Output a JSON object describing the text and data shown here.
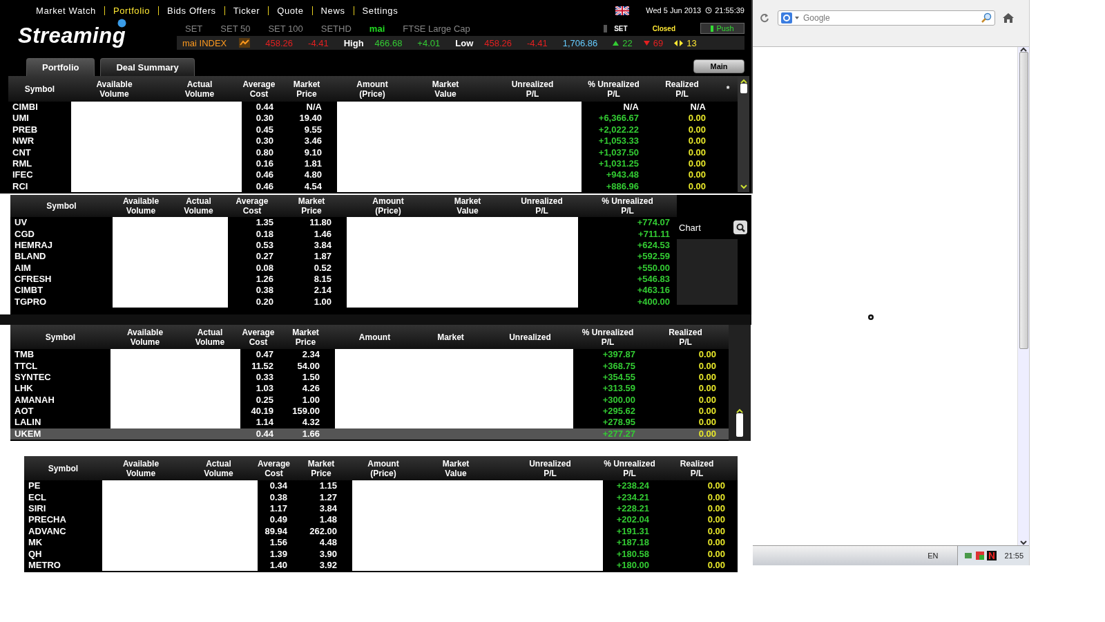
{
  "menu": [
    {
      "label": "Market Watch",
      "selected": false
    },
    {
      "label": "Portfolio",
      "selected": true
    },
    {
      "label": "Bids Offers",
      "selected": false
    },
    {
      "label": "Ticker",
      "selected": false
    },
    {
      "label": "Quote",
      "selected": false
    },
    {
      "label": "News",
      "selected": false
    },
    {
      "label": "Settings",
      "selected": false
    }
  ],
  "date": "Wed 5 Jun 2013",
  "time": "21:55:39",
  "logo": "Streaming",
  "index_tabs": [
    {
      "label": "SET",
      "selected": false
    },
    {
      "label": "SET 50",
      "selected": false
    },
    {
      "label": "SET 100",
      "selected": false
    },
    {
      "label": "SETHD",
      "selected": false
    },
    {
      "label": "mai",
      "selected": true
    },
    {
      "label": "FTSE Large Cap",
      "selected": false
    }
  ],
  "market": {
    "name": "SET",
    "status": "Closed",
    "push_button": "Push"
  },
  "ticker": [
    {
      "kind": "name",
      "text": "mai INDEX"
    },
    {
      "kind": "down",
      "text": "458.26"
    },
    {
      "kind": "down",
      "text": "-4.41"
    },
    {
      "kind": "label",
      "text": "High"
    },
    {
      "kind": "up",
      "text": "466.68"
    },
    {
      "kind": "up",
      "text": "+4.01"
    },
    {
      "kind": "label",
      "text": "Low"
    },
    {
      "kind": "down",
      "text": "458.26"
    },
    {
      "kind": "down",
      "text": "-4.41"
    },
    {
      "kind": "value",
      "text": "1,706.86"
    },
    {
      "kind": "advances",
      "text": "22"
    },
    {
      "kind": "declines",
      "text": "69"
    },
    {
      "kind": "unchanged",
      "text": "13"
    }
  ],
  "tabs": [
    {
      "label": "Portfolio",
      "selected": true
    },
    {
      "label": "Deal Summary",
      "selected": false
    }
  ],
  "main_button": "Main",
  "panels": [
    {
      "columns": [
        "Symbol",
        "Available\nVolume",
        "Actual\nVolume",
        "Average\nCost",
        "Market\nPrice",
        "Amount\n(Price)",
        "Market\nValue",
        "Unrealized\nP/L",
        "% Unrealized\nP/L",
        "Realized\nP/L",
        "*"
      ],
      "rows": [
        {
          "symbol": "CIMBI",
          "avg_cost": "0.44",
          "price": "N/A",
          "pct": "N/A",
          "realized": "N/A",
          "positive": false
        },
        {
          "symbol": "UMI",
          "avg_cost": "0.30",
          "price": "19.40",
          "pct": "+6,366.67",
          "realized": "0.00",
          "positive": true
        },
        {
          "symbol": "PREB",
          "avg_cost": "0.45",
          "price": "9.55",
          "pct": "+2,022.22",
          "realized": "0.00",
          "positive": true
        },
        {
          "symbol": "NWR",
          "avg_cost": "0.30",
          "price": "3.46",
          "pct": "+1,053.33",
          "realized": "0.00",
          "positive": true
        },
        {
          "symbol": "CNT",
          "avg_cost": "0.80",
          "price": "9.10",
          "pct": "+1,037.50",
          "realized": "0.00",
          "positive": true
        },
        {
          "symbol": "RML",
          "avg_cost": "0.16",
          "price": "1.81",
          "pct": "+1,031.25",
          "realized": "0.00",
          "positive": true
        },
        {
          "symbol": "IFEC",
          "avg_cost": "0.46",
          "price": "4.80",
          "pct": "+943.48",
          "realized": "0.00",
          "positive": true
        },
        {
          "symbol": "RCI",
          "avg_cost": "0.46",
          "price": "4.54",
          "pct": "+886.96",
          "realized": "0.00",
          "positive": true
        }
      ]
    },
    {
      "columns": [
        "Symbol",
        "Available\nVolume",
        "Actual\nVolume",
        "Average\nCost",
        "Market\nPrice",
        "Amount\n(Price)",
        "Market\nValue",
        "Unrealized\nP/L",
        "% Unrealized\nP/L"
      ],
      "rows": [
        {
          "symbol": "UV",
          "avg_cost": "1.35",
          "price": "11.80",
          "pct": "+774.07",
          "positive": true
        },
        {
          "symbol": "CGD",
          "avg_cost": "0.18",
          "price": "1.46",
          "pct": "+711.11",
          "positive": true
        },
        {
          "symbol": "HEMRAJ",
          "avg_cost": "0.53",
          "price": "3.84",
          "pct": "+624.53",
          "positive": true
        },
        {
          "symbol": "BLAND",
          "avg_cost": "0.27",
          "price": "1.87",
          "pct": "+592.59",
          "positive": true
        },
        {
          "symbol": "AIM",
          "avg_cost": "0.08",
          "price": "0.52",
          "pct": "+550.00",
          "positive": true
        },
        {
          "symbol": "CFRESH",
          "avg_cost": "1.26",
          "price": "8.15",
          "pct": "+546.83",
          "positive": true
        },
        {
          "symbol": "CIMBT",
          "avg_cost": "0.38",
          "price": "2.14",
          "pct": "+463.16",
          "positive": true
        },
        {
          "symbol": "TGPRO",
          "avg_cost": "0.20",
          "price": "1.00",
          "pct": "+400.00",
          "positive": true
        }
      ],
      "side": {
        "title": "Chart"
      }
    },
    {
      "columns": [
        "Symbol",
        "Available\nVolume",
        "Actual\nVolume",
        "Average\nCost",
        "Market\nPrice",
        "Amount",
        "Market",
        "Unrealized",
        "% Unrealized\nP/L",
        "Realized\nP/L"
      ],
      "rows": [
        {
          "symbol": "TMB",
          "avg_cost": "0.47",
          "price": "2.34",
          "pct": "+397.87",
          "realized": "0.00",
          "positive": true,
          "selected": false
        },
        {
          "symbol": "TTCL",
          "avg_cost": "11.52",
          "price": "54.00",
          "pct": "+368.75",
          "realized": "0.00",
          "positive": true,
          "selected": false
        },
        {
          "symbol": "SYNTEC",
          "avg_cost": "0.33",
          "price": "1.50",
          "pct": "+354.55",
          "realized": "0.00",
          "positive": true,
          "selected": false
        },
        {
          "symbol": "LHK",
          "avg_cost": "1.03",
          "price": "4.26",
          "pct": "+313.59",
          "realized": "0.00",
          "positive": true,
          "selected": false
        },
        {
          "symbol": "AMANAH",
          "avg_cost": "0.25",
          "price": "1.00",
          "pct": "+300.00",
          "realized": "0.00",
          "positive": true,
          "selected": false
        },
        {
          "symbol": "AOT",
          "avg_cost": "40.19",
          "price": "159.00",
          "pct": "+295.62",
          "realized": "0.00",
          "positive": true,
          "selected": false
        },
        {
          "symbol": "LALIN",
          "avg_cost": "1.14",
          "price": "4.32",
          "pct": "+278.95",
          "realized": "0.00",
          "positive": true,
          "selected": false
        },
        {
          "symbol": "UKEM",
          "avg_cost": "0.44",
          "price": "1.66",
          "pct": "+277.27",
          "realized": "0.00",
          "positive": true,
          "selected": true
        }
      ]
    },
    {
      "columns": [
        "Symbol",
        "Available\nVolume",
        "Actual\nVolume",
        "Average\nCost",
        "Market\nPrice",
        "Amount\n(Price)",
        "Market\nValue",
        "Unrealized\nP/L",
        "% Unrealized\nP/L",
        "Realized\nP/L"
      ],
      "rows": [
        {
          "symbol": "PE",
          "avg_cost": "0.34",
          "price": "1.15",
          "pct": "+238.24",
          "realized": "0.00",
          "positive": true
        },
        {
          "symbol": "ECL",
          "avg_cost": "0.38",
          "price": "1.27",
          "pct": "+234.21",
          "realized": "0.00",
          "positive": true
        },
        {
          "symbol": "SIRI",
          "avg_cost": "1.17",
          "price": "3.84",
          "pct": "+228.21",
          "realized": "0.00",
          "positive": true
        },
        {
          "symbol": "PRECHA",
          "avg_cost": "0.49",
          "price": "1.48",
          "pct": "+202.04",
          "realized": "0.00",
          "positive": true
        },
        {
          "symbol": "ADVANC",
          "avg_cost": "89.94",
          "price": "262.00",
          "pct": "+191.31",
          "realized": "0.00",
          "positive": true
        },
        {
          "symbol": "MK",
          "avg_cost": "1.56",
          "price": "4.48",
          "pct": "+187.18",
          "realized": "0.00",
          "positive": true
        },
        {
          "symbol": "QH",
          "avg_cost": "1.39",
          "price": "3.90",
          "pct": "+180.58",
          "realized": "0.00",
          "positive": true
        },
        {
          "symbol": "METRO",
          "avg_cost": "1.40",
          "price": "3.92",
          "pct": "+180.00",
          "realized": "0.00",
          "positive": true
        }
      ]
    }
  ],
  "browser": {
    "search_placeholder": "Google"
  },
  "taskbar": {
    "language": "EN",
    "clock": "21:55"
  }
}
